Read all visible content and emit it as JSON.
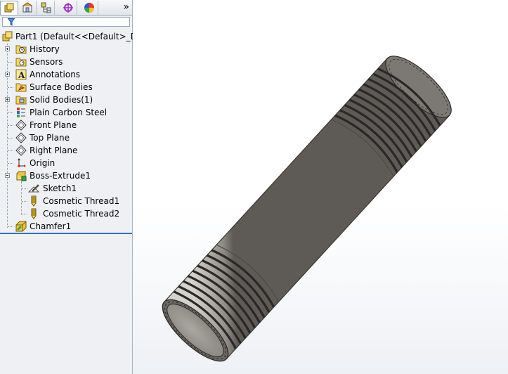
{
  "panel": {
    "tabs": [
      "feature-manager-icon",
      "property-manager-icon",
      "configuration-manager-icon",
      "dimxpert-manager-icon",
      "display-manager-icon"
    ],
    "more_tabs_glyph": "»",
    "filter_icon": "filter-icon"
  },
  "tree": {
    "root": {
      "label": "Part1  (Default<<Default>_Disp",
      "icon": "part-icon"
    },
    "items": [
      {
        "label": "History",
        "icon": "history-folder-icon",
        "expandable": true
      },
      {
        "label": "Sensors",
        "icon": "sensors-folder-icon",
        "expandable": false
      },
      {
        "label": "Annotations",
        "icon": "annotations-icon",
        "expandable": true
      },
      {
        "label": "Surface Bodies",
        "icon": "surface-bodies-folder-icon",
        "expandable": false
      },
      {
        "label": "Solid Bodies(1)",
        "icon": "solid-bodies-folder-icon",
        "expandable": true
      },
      {
        "label": "Plain Carbon Steel",
        "icon": "material-icon",
        "expandable": false
      },
      {
        "label": "Front Plane",
        "icon": "plane-icon",
        "expandable": false
      },
      {
        "label": "Top Plane",
        "icon": "plane-icon",
        "expandable": false
      },
      {
        "label": "Right Plane",
        "icon": "plane-icon",
        "expandable": false
      },
      {
        "label": "Origin",
        "icon": "origin-icon",
        "expandable": false
      },
      {
        "label": "Boss-Extrude1",
        "icon": "extrude-icon",
        "expandable": true,
        "expanded": true
      },
      {
        "label": "Sketch1",
        "icon": "sketch-icon",
        "child": true
      },
      {
        "label": "Cosmetic Thread1",
        "icon": "cosmetic-thread-icon",
        "child": true
      },
      {
        "label": "Cosmetic Thread2",
        "icon": "cosmetic-thread-icon",
        "child": true
      },
      {
        "label": "Chamfer1",
        "icon": "chamfer-icon",
        "expandable": false
      }
    ]
  },
  "colors": {
    "panel_bg": "#eef0f4",
    "rollback_bar": "#3a6fb0",
    "model_body": "#8f8c85",
    "model_dark": "#2e2c2a"
  }
}
